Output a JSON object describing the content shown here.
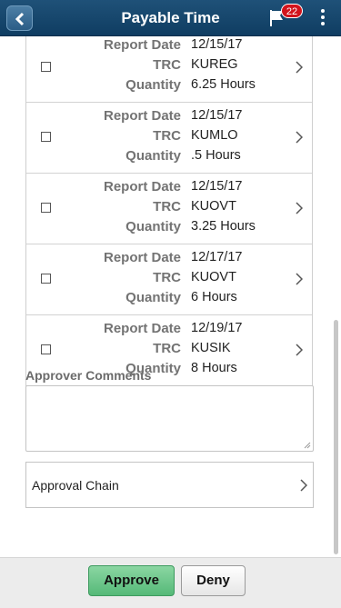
{
  "header": {
    "title": "Payable Time",
    "notification_count": "22"
  },
  "entries": [
    {
      "report_date_label": "Report Date",
      "report_date": "12/15/17",
      "trc_label": "TRC",
      "trc": "KUREG",
      "quantity_label": "Quantity",
      "quantity": "6.25 Hours"
    },
    {
      "report_date_label": "Report Date",
      "report_date": "12/15/17",
      "trc_label": "TRC",
      "trc": "KUMLO",
      "quantity_label": "Quantity",
      "quantity": ".5 Hours"
    },
    {
      "report_date_label": "Report Date",
      "report_date": "12/15/17",
      "trc_label": "TRC",
      "trc": "KUOVT",
      "quantity_label": "Quantity",
      "quantity": "3.25 Hours"
    },
    {
      "report_date_label": "Report Date",
      "report_date": "12/17/17",
      "trc_label": "TRC",
      "trc": "KUOVT",
      "quantity_label": "Quantity",
      "quantity": "6 Hours"
    },
    {
      "report_date_label": "Report Date",
      "report_date": "12/19/17",
      "trc_label": "TRC",
      "trc": "KUSIK",
      "quantity_label": "Quantity",
      "quantity": "8 Hours"
    }
  ],
  "comments": {
    "label": "Approver Comments",
    "value": ""
  },
  "approval_chain": {
    "label": "Approval Chain"
  },
  "footer": {
    "approve_label": "Approve",
    "deny_label": "Deny"
  },
  "colors": {
    "header_bg": "#1a4a70",
    "approve_bg": "#6cc78b",
    "badge_bg": "#d2141c"
  }
}
